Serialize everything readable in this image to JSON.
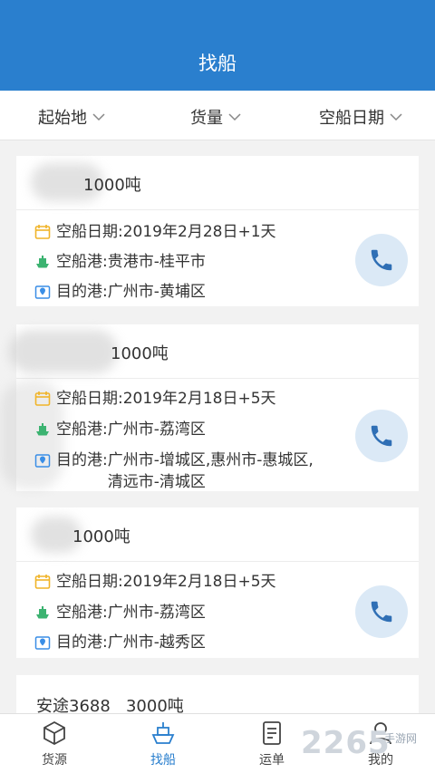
{
  "header": {
    "title": "找船"
  },
  "filters": [
    {
      "label": "起始地"
    },
    {
      "label": "货量"
    },
    {
      "label": "空船日期"
    }
  ],
  "cards": [
    {
      "title": "1000吨",
      "date_label": "空船日期",
      "date": "2019年2月28日+1天",
      "port_label": "空船港",
      "port": "贵港市-桂平市",
      "dest_label": "目的港",
      "dest_lines": [
        "广州市-黄埔区"
      ]
    },
    {
      "title": "1000吨",
      "date_label": "空船日期",
      "date": "2019年2月18日+5天",
      "port_label": "空船港",
      "port": "广州市-荔湾区",
      "dest_label": "目的港",
      "dest_lines": [
        "广州市-增城区,惠州市-惠城区,",
        "清远市-清城区"
      ]
    },
    {
      "title": "1000吨",
      "date_label": "空船日期",
      "date": "2019年2月18日+5天",
      "port_label": "空船港",
      "port": "广州市-荔湾区",
      "dest_label": "目的港",
      "dest_lines": [
        "广州市-越秀区"
      ]
    },
    {
      "title": "安途3688   3000吨"
    }
  ],
  "tabs": [
    {
      "label": "货源",
      "icon": "box-icon"
    },
    {
      "label": "找船",
      "icon": "ship-icon"
    },
    {
      "label": "运单",
      "icon": "waybill-icon"
    },
    {
      "label": "我的",
      "icon": "user-icon"
    }
  ],
  "watermark": {
    "text": "2265",
    "sub": "手游网"
  },
  "colors": {
    "primary": "#2a7fce",
    "call_bg": "#dbe9f6",
    "calendar": "#f0b429",
    "ship": "#3cb371",
    "pin": "#3a8ee6"
  }
}
